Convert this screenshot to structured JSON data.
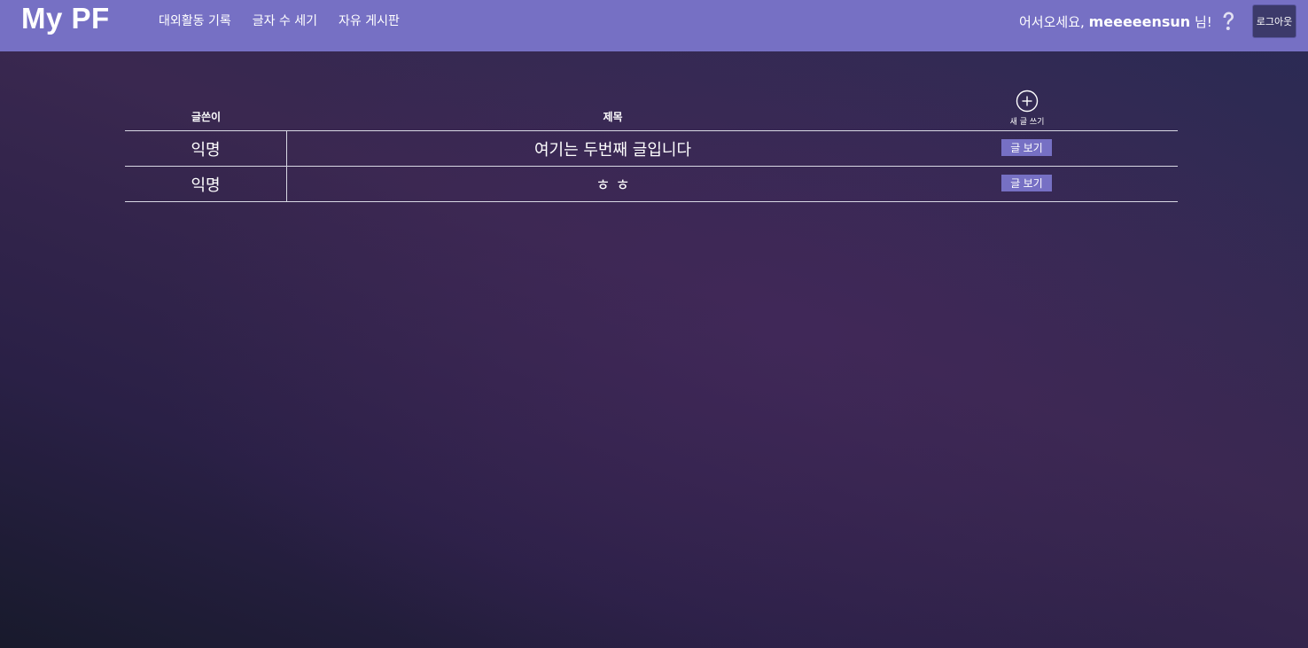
{
  "nav": {
    "brand": "My PF",
    "links": [
      "대외활동 기록",
      "글자 수 세기",
      "자유 게시판"
    ],
    "greeting_prefix": "어서오세요,",
    "username": "meeeeensun",
    "greeting_suffix": "님!",
    "help_icon": "question-icon",
    "logout_label": "로그아웃"
  },
  "board": {
    "columns": {
      "author": "글쓴이",
      "title": "제목"
    },
    "new_post_label": "새 글 쓰기",
    "new_post_icon": "plus-circle-icon",
    "rows": [
      {
        "author": "익명",
        "title": "여기는 두번째 글입니다",
        "button": "글 보기"
      },
      {
        "author": "익명",
        "title": "ㅎ ㅎ",
        "button": "글 보기"
      }
    ]
  },
  "colors": {
    "navbar": "#7670c4",
    "button": "#7670c4",
    "logout": "#3c3a6a"
  }
}
